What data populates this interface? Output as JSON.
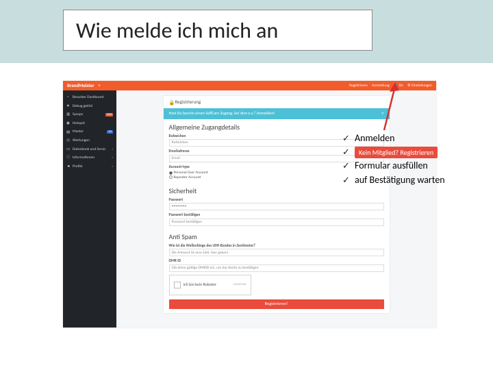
{
  "slide": {
    "title": "Wie melde ich mich an"
  },
  "app": {
    "brand": "BrandMeister",
    "top_links": {
      "register": "Registrieren",
      "login": "Anmeldung",
      "lang": "De",
      "settings": "Einstellungen"
    },
    "sidebar": {
      "items": [
        {
          "label": "Benutzer Dashboard"
        },
        {
          "label": "Debug gelöst"
        },
        {
          "label": "Sysops",
          "badge": "164"
        },
        {
          "label": "Hotspot"
        },
        {
          "label": "Master",
          "badge": "62",
          "badge_color": "blue"
        },
        {
          "label": "Wartungen"
        },
        {
          "label": "Datenbank und Servic",
          "chev": true
        },
        {
          "label": "Informationen",
          "chev": true
        },
        {
          "label": "Profile",
          "chev": true
        }
      ]
    },
    "panel": {
      "reg_title": "Registrierung",
      "alert_text": "Hast Du bereits einen SelfCare Zugang, bei dmr-e.v.? Anmelden!",
      "alert_x": "×",
      "h_details": "Allgemeine Zugangdetails",
      "lbl_callsign": "Rufzeichen",
      "ph_callsign": "Rufzeichen",
      "lbl_email": "Emailadresse",
      "ph_email": "Email",
      "lbl_acctype": "Account-type",
      "radio1": "Personal User Account",
      "radio2": "Repeater Account",
      "h_security": "Sicherheit",
      "lbl_pw": "Passwort",
      "pw_dots": "••••••••",
      "lbl_pw2": "Passwort bestätigen",
      "ph_pw2": "Passwort bestätigen",
      "h_antispam": "Anti Spam",
      "lbl_wave": "Wie ist die Wellenlänge des UHF-Bandes in Zentimeter?",
      "ph_wave": "Die Antwort ist eine Zahl, hier geben!",
      "lbl_dmrid": "DMR ID",
      "ph_dmrid": "Gib deine gültige DMRID ein, um das Konto zu bestätigen",
      "captcha_label": "Ich bin kein Roboter",
      "captcha_brand": "reCAPTCHA",
      "submit": "Registrieren!"
    }
  },
  "checklist": {
    "check": "✓",
    "items": {
      "0": "Anmelden",
      "1_badge": "Kein Mitglied? Registrieren",
      "2": "Formular ausfüllen",
      "3": "auf Bestätigung warten"
    }
  }
}
